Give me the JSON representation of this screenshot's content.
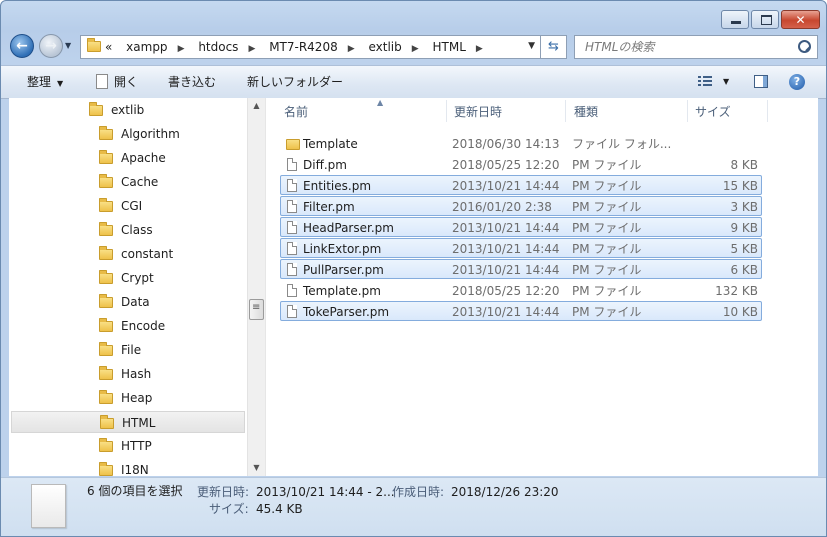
{
  "window": {
    "min_glyph": "",
    "max_glyph": "",
    "close_glyph": "✕"
  },
  "nav": {
    "breadcrumbs": [
      "«",
      "xampp",
      "htdocs",
      "MT7-R4208",
      "extlib",
      "HTML"
    ],
    "search_placeholder": "HTMLの検索"
  },
  "toolbar": {
    "organize": "整理",
    "open": "開く",
    "burn": "書き込む",
    "new_folder": "新しいフォルダー"
  },
  "tree": {
    "root": "extlib",
    "items": [
      "Algorithm",
      "Apache",
      "Cache",
      "CGI",
      "Class",
      "constant",
      "Crypt",
      "Data",
      "Encode",
      "File",
      "Hash",
      "Heap",
      "HTML",
      "HTTP",
      "I18N"
    ],
    "selected": "HTML"
  },
  "columns": {
    "name": "名前",
    "date": "更新日時",
    "type": "種類",
    "size": "サイズ"
  },
  "files": [
    {
      "name": "Template",
      "date": "2018/06/30 14:13",
      "type": "ファイル フォル...",
      "size": "",
      "kind": "folder",
      "selected": false
    },
    {
      "name": "Diff.pm",
      "date": "2018/05/25 12:20",
      "type": "PM ファイル",
      "size": "8 KB",
      "kind": "file",
      "selected": false
    },
    {
      "name": "Entities.pm",
      "date": "2013/10/21 14:44",
      "type": "PM ファイル",
      "size": "15 KB",
      "kind": "file",
      "selected": true
    },
    {
      "name": "Filter.pm",
      "date": "2016/01/20 2:38",
      "type": "PM ファイル",
      "size": "3 KB",
      "kind": "file",
      "selected": true
    },
    {
      "name": "HeadParser.pm",
      "date": "2013/10/21 14:44",
      "type": "PM ファイル",
      "size": "9 KB",
      "kind": "file",
      "selected": true
    },
    {
      "name": "LinkExtor.pm",
      "date": "2013/10/21 14:44",
      "type": "PM ファイル",
      "size": "5 KB",
      "kind": "file",
      "selected": true
    },
    {
      "name": "PullParser.pm",
      "date": "2013/10/21 14:44",
      "type": "PM ファイル",
      "size": "6 KB",
      "kind": "file",
      "selected": true
    },
    {
      "name": "Template.pm",
      "date": "2018/05/25 12:20",
      "type": "PM ファイル",
      "size": "132 KB",
      "kind": "file",
      "selected": false
    },
    {
      "name": "TokeParser.pm",
      "date": "2013/10/21 14:44",
      "type": "PM ファイル",
      "size": "10 KB",
      "kind": "file",
      "selected": true
    }
  ],
  "details": {
    "selection_count": "6 個の項目を選択",
    "modified_label": "更新日時:",
    "modified_value": "2013/10/21 14:44 - 2...",
    "created_label": "作成日時:",
    "created_value": "2018/12/26 23:20",
    "size_label": "サイズ:",
    "size_value": "45.4 KB"
  }
}
